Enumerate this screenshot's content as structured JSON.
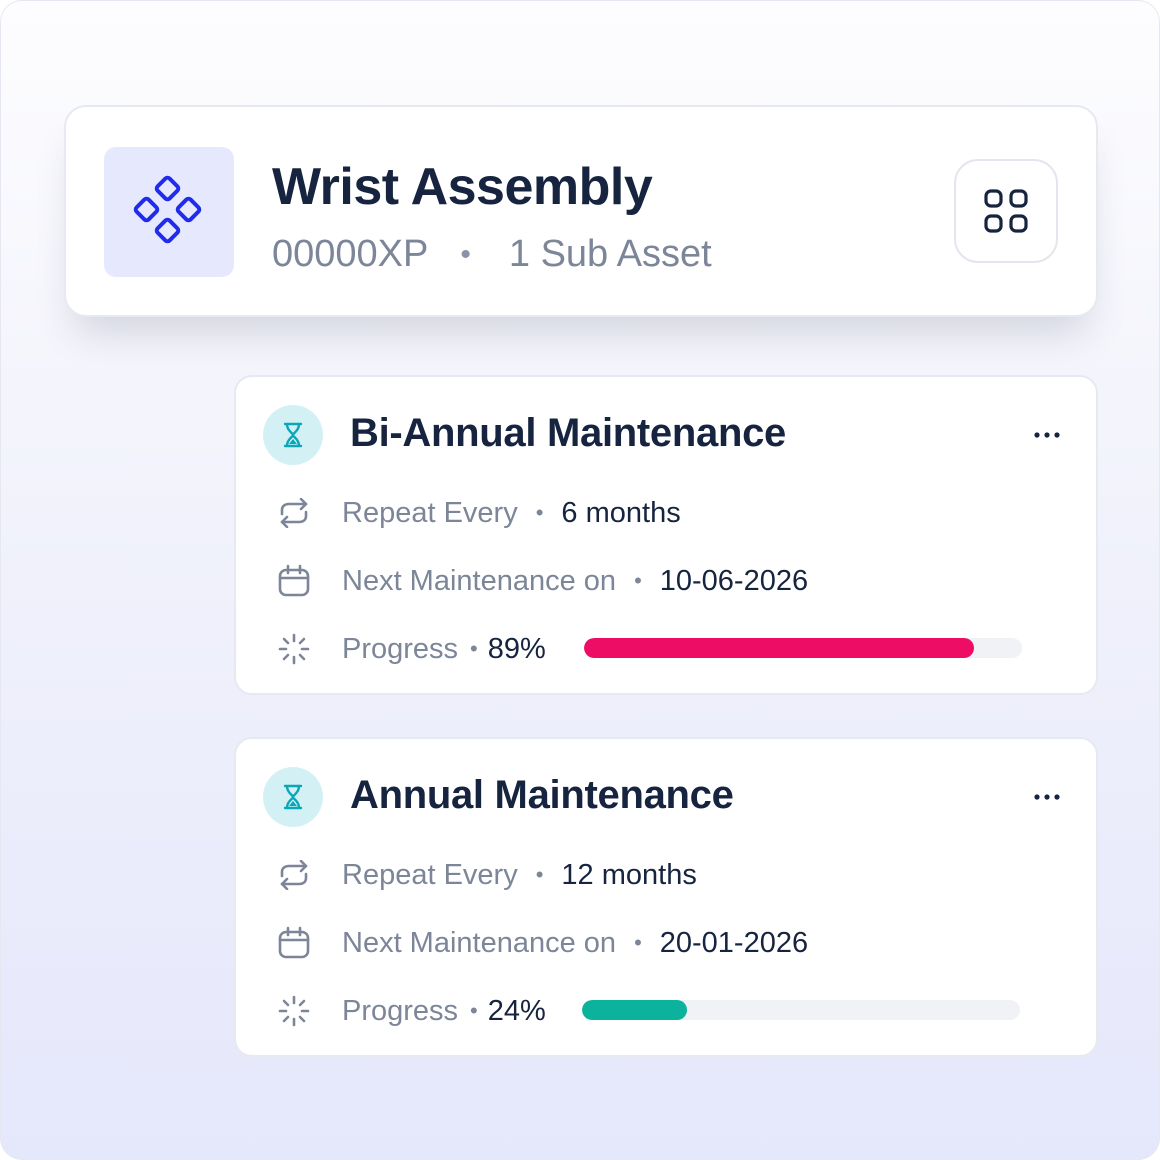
{
  "asset": {
    "title": "Wrist Assembly",
    "code": "00000XP",
    "separator": "•",
    "sub_assets": "1 Sub Asset",
    "icon": "diamond-cluster-icon",
    "accent_color": "#1f2bef",
    "grid_button_icon": "grid-icon"
  },
  "tasks": [
    {
      "title": "Bi-Annual Maintenance",
      "icon": "hourglass-icon",
      "menu_icon": "more-horizontal-icon",
      "repeat_label": "Repeat Every",
      "repeat_value": "6 months",
      "next_label": "Next Maintenance on",
      "next_value": "10-06-2026",
      "progress_label": "Progress",
      "progress_text": "89%",
      "progress": 0.89,
      "progress_color": "#ee0d64",
      "separator": "•"
    },
    {
      "title": "Annual Maintenance",
      "icon": "hourglass-icon",
      "menu_icon": "more-horizontal-icon",
      "repeat_label": "Repeat Every",
      "repeat_value": "12 months",
      "next_label": "Next Maintenance on",
      "next_value": "20-01-2026",
      "progress_label": "Progress",
      "progress_text": "24%",
      "progress": 0.24,
      "progress_color": "#0bb39c",
      "separator": "•"
    }
  ]
}
